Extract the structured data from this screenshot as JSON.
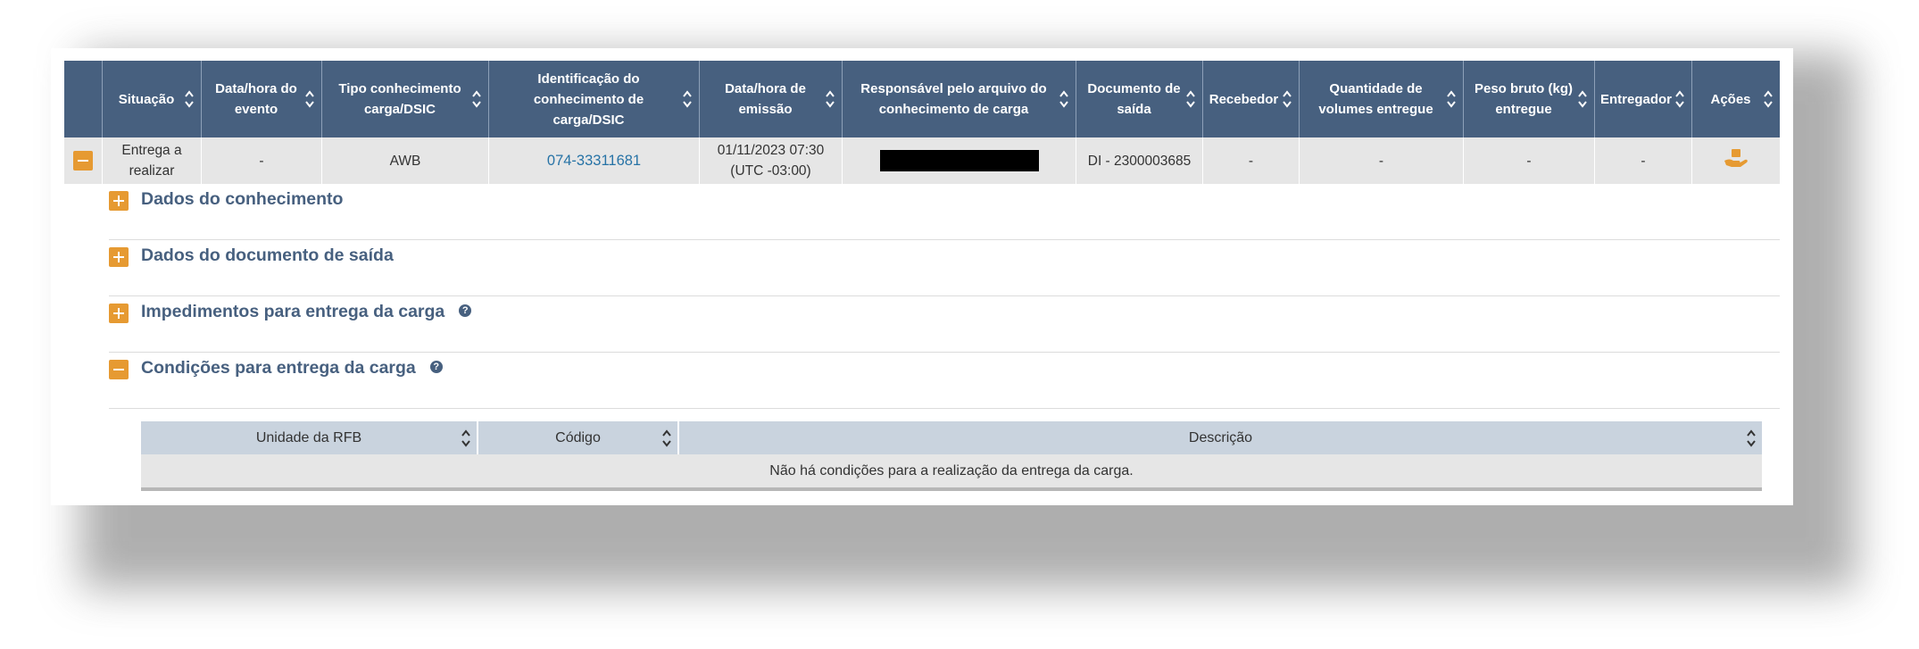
{
  "table": {
    "headers": [
      {
        "label": ""
      },
      {
        "label": "Situação"
      },
      {
        "label": "Data/hora do evento"
      },
      {
        "label": "Tipo conhecimento carga/DSIC"
      },
      {
        "label": "Identificação do conhecimento de carga/DSIC"
      },
      {
        "label": "Data/hora de emissão"
      },
      {
        "label": "Responsável pelo arquivo do conhecimento de carga"
      },
      {
        "label": "Documento de saída"
      },
      {
        "label": "Recebedor"
      },
      {
        "label": "Quantidade de volumes entregue"
      },
      {
        "label": "Peso bruto (kg) entregue"
      },
      {
        "label": "Entregador"
      },
      {
        "label": "Ações"
      }
    ],
    "row": {
      "situacao": "Entrega a realizar",
      "data_evento": "-",
      "tipo": "AWB",
      "identificacao": "074-33311681",
      "data_emissao": "01/11/2023 07:30 (UTC -03:00)",
      "documento_saida": "DI - 2300003685",
      "recebedor": "-",
      "quantidade": "-",
      "peso": "-",
      "entregador": "-"
    }
  },
  "sections": [
    {
      "title": "Dados do conhecimento",
      "expanded": false
    },
    {
      "title": "Dados do documento de saída",
      "expanded": false
    },
    {
      "title": "Impedimentos para entrega da carga",
      "expanded": false,
      "help": true
    },
    {
      "title": "Condições para entrega da carga",
      "expanded": true,
      "help": true
    }
  ],
  "conditions_table": {
    "headers": [
      "Unidade da RFB",
      "Código",
      "Descrição"
    ],
    "empty_message": "Não há condições para a realização da entrega da carga."
  },
  "colors": {
    "header_bg": "#47607f",
    "accent_orange": "#e69a32",
    "link": "#2773a6",
    "row_bg": "#e6e6e6",
    "inner_header_bg": "#c9d3de"
  },
  "icons": {
    "sort": "sort-icon",
    "expand": "plus-icon",
    "collapse": "minus-icon",
    "help": "question-icon",
    "action": "hand-delivery-icon"
  }
}
